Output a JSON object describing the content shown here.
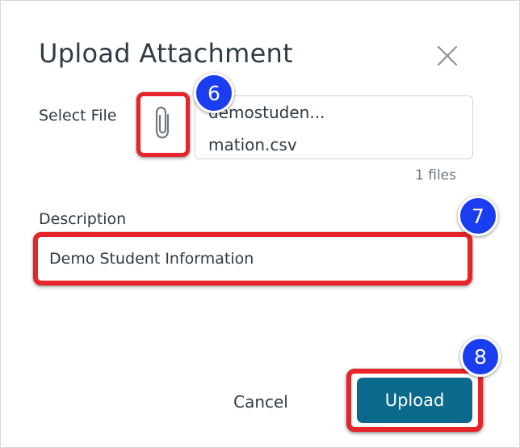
{
  "dialog": {
    "title": "Upload Attachment",
    "close_icon": "close-icon"
  },
  "select_file": {
    "label": "Select File",
    "attach_icon": "paperclip-icon",
    "file_name_line1": "demostuden...",
    "file_name_line2": "mation.csv",
    "file_count": "1 files"
  },
  "description": {
    "label": "Description",
    "value": "Demo Student Information"
  },
  "actions": {
    "cancel_label": "Cancel",
    "upload_label": "Upload"
  },
  "annotations": {
    "step_6": "6",
    "step_7": "7",
    "step_8": "8",
    "highlight_color": "#e62429",
    "badge_color": "#1b3df0"
  },
  "colors": {
    "upload_button": "#0b6a8c",
    "text": "#2d3b45"
  }
}
